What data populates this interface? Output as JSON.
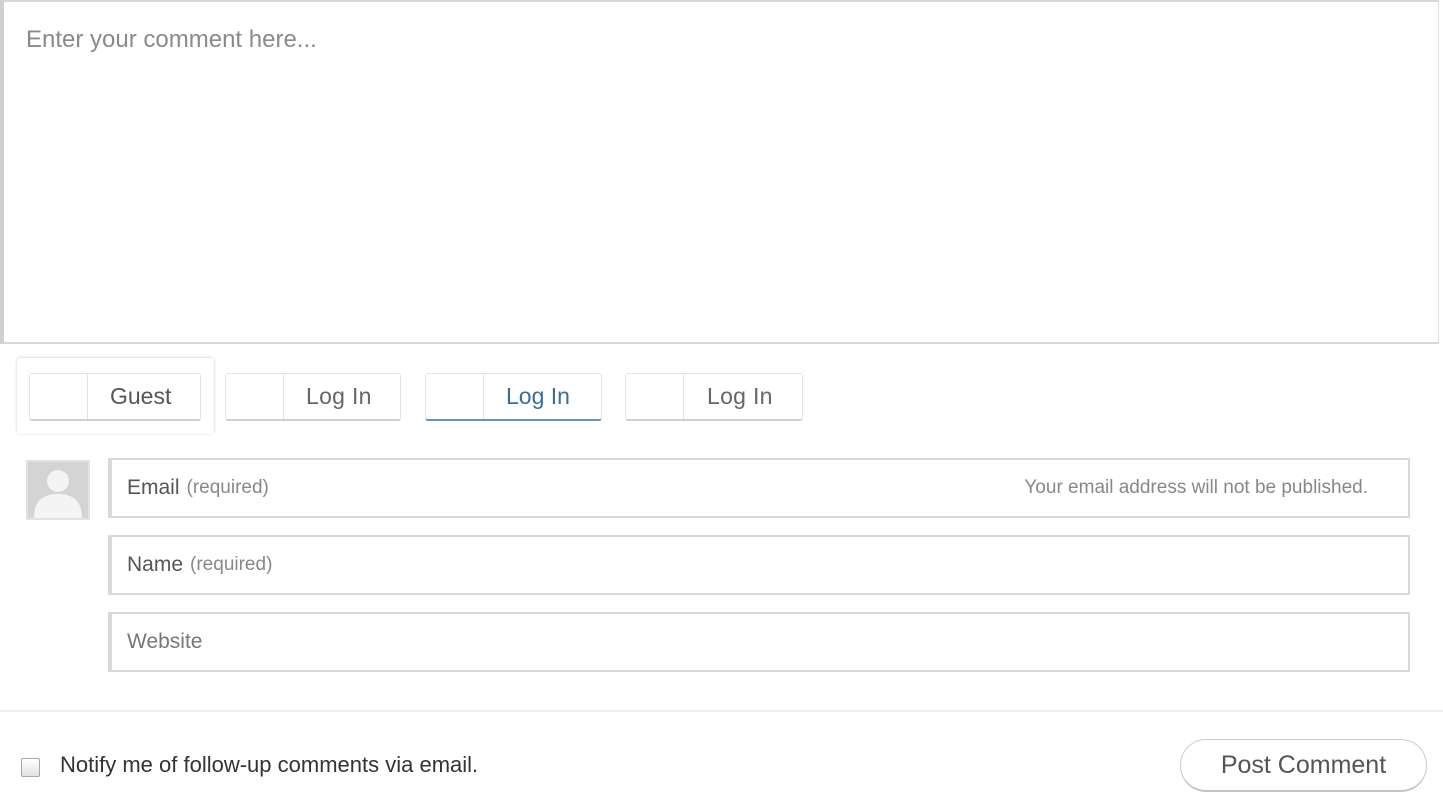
{
  "comment": {
    "placeholder": "Enter your comment here..."
  },
  "identity_tabs": [
    {
      "label": "Guest",
      "active": true
    },
    {
      "label": "Log In",
      "active": false
    },
    {
      "label": "Log In",
      "active": false
    },
    {
      "label": "Log In",
      "active": false
    }
  ],
  "guest_form": {
    "avatar_icon": "default-avatar-icon",
    "email": {
      "label": "Email",
      "hint": "(required)",
      "note": "Your email address will not be published.",
      "value": ""
    },
    "name": {
      "label": "Name",
      "hint": "(required)",
      "value": ""
    },
    "website": {
      "label": "Website",
      "value": ""
    }
  },
  "footer": {
    "notify_label": "Notify me of follow-up comments via email.",
    "notify_checked": false,
    "post_button_label": "Post Comment"
  },
  "colors": {
    "login_link": "#3b6e95",
    "border": "#d9d9d9"
  }
}
